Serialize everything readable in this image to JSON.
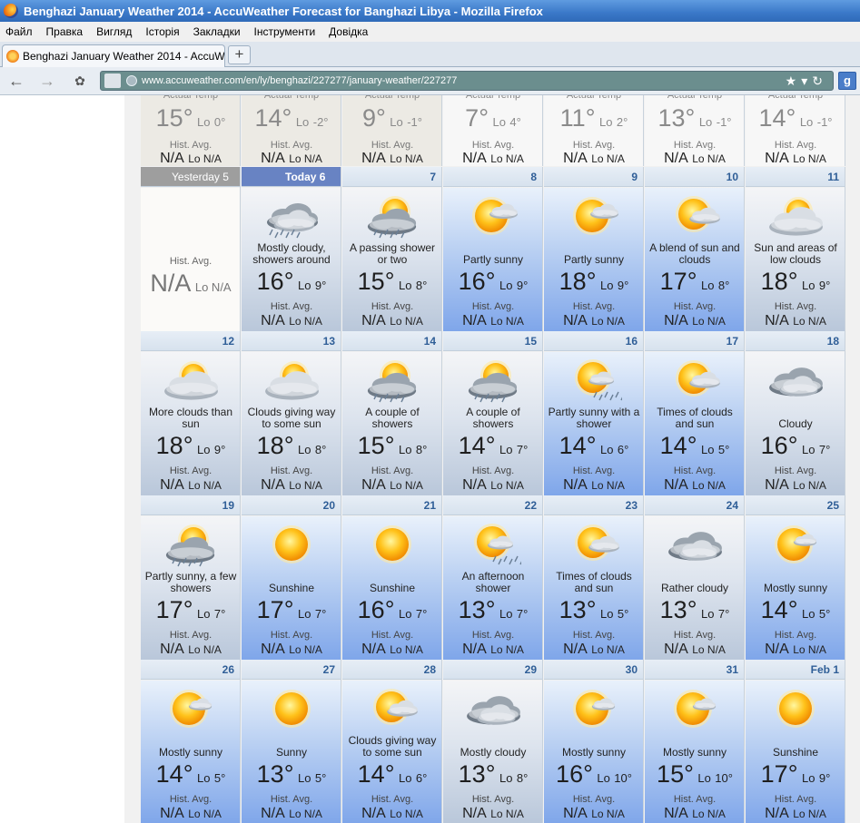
{
  "window": {
    "title": "Benghazi January Weather 2014 - AccuWeather Forecast for Banghazi Libya - Mozilla Firefox"
  },
  "menu": [
    "Файл",
    "Правка",
    "Вигляд",
    "Історія",
    "Закладки",
    "Інструменти",
    "Довідка"
  ],
  "tab": {
    "title": "Benghazi January Weather 2014 - AccuWea...",
    "new_tab": "+"
  },
  "nav": {
    "url": "www.accuweather.com/en/ly/benghazi/227277/january-weather/227277",
    "search_logo": "g"
  },
  "labels": {
    "actual_temp": "Actual Temp",
    "hist_avg": "Hist. Avg.",
    "na": "N/A",
    "lo": "Lo",
    "lo_na": "Lo N/A",
    "degree": "°"
  },
  "previous_row": [
    {
      "hi": "15",
      "lo": "0"
    },
    {
      "hi": "14",
      "lo": "-2"
    },
    {
      "hi": "9",
      "lo": "-1"
    },
    {
      "hi": "7",
      "lo": "4"
    },
    {
      "hi": "11",
      "lo": "2"
    },
    {
      "hi": "13",
      "lo": "-1"
    },
    {
      "hi": "14",
      "lo": "-1"
    }
  ],
  "weeks": [
    [
      {
        "day": "Yesterday 5",
        "kind": "yesterday"
      },
      {
        "day": "Today 6",
        "kind": "today",
        "icon": "cloud-showers-icon",
        "desc": "Mostly cloudy, showers around",
        "hi": "16",
        "lo": "9"
      },
      {
        "day": "7",
        "icon": "sun-cloud-showers-icon",
        "desc": "A passing shower or two",
        "hi": "15",
        "lo": "8"
      },
      {
        "day": "8",
        "icon": "partly-sunny-icon",
        "desc": "Partly sunny",
        "hi": "16",
        "lo": "9"
      },
      {
        "day": "9",
        "icon": "partly-sunny-icon",
        "desc": "Partly sunny",
        "hi": "18",
        "lo": "9"
      },
      {
        "day": "10",
        "icon": "sun-clouds-icon",
        "desc": "A blend of sun and clouds",
        "hi": "17",
        "lo": "8"
      },
      {
        "day": "11",
        "icon": "cloud-sun-icon",
        "desc": "Sun and areas of low clouds",
        "hi": "18",
        "lo": "9"
      }
    ],
    [
      {
        "day": "12",
        "icon": "cloud-sun-icon",
        "desc": "More clouds than sun",
        "hi": "18",
        "lo": "9"
      },
      {
        "day": "13",
        "icon": "cloud-sun-icon",
        "desc": "Clouds giving way to some sun",
        "hi": "18",
        "lo": "8"
      },
      {
        "day": "14",
        "icon": "sun-cloud-showers-icon",
        "desc": "A couple of showers",
        "hi": "15",
        "lo": "8"
      },
      {
        "day": "15",
        "icon": "sun-cloud-showers-icon",
        "desc": "A couple of showers",
        "hi": "14",
        "lo": "7"
      },
      {
        "day": "16",
        "icon": "sun-shower-icon",
        "desc": "Partly sunny with a shower",
        "hi": "14",
        "lo": "6"
      },
      {
        "day": "17",
        "icon": "sun-clouds-icon",
        "desc": "Times of clouds and sun",
        "hi": "14",
        "lo": "5"
      },
      {
        "day": "18",
        "icon": "cloud-icon",
        "desc": "Cloudy",
        "hi": "16",
        "lo": "7"
      }
    ],
    [
      {
        "day": "19",
        "icon": "sun-cloud-showers-icon",
        "desc": "Partly sunny, a few showers",
        "hi": "17",
        "lo": "7"
      },
      {
        "day": "20",
        "icon": "sun-icon",
        "desc": "Sunshine",
        "hi": "17",
        "lo": "7"
      },
      {
        "day": "21",
        "icon": "sun-icon",
        "desc": "Sunshine",
        "hi": "16",
        "lo": "7"
      },
      {
        "day": "22",
        "icon": "sun-shower-icon",
        "desc": "An afternoon shower",
        "hi": "13",
        "lo": "7"
      },
      {
        "day": "23",
        "icon": "sun-clouds-icon",
        "desc": "Times of clouds and sun",
        "hi": "13",
        "lo": "5"
      },
      {
        "day": "24",
        "icon": "cloud-icon",
        "desc": "Rather cloudy",
        "hi": "13",
        "lo": "7"
      },
      {
        "day": "25",
        "icon": "mostly-sunny-icon",
        "desc": "Mostly sunny",
        "hi": "14",
        "lo": "5"
      }
    ],
    [
      {
        "day": "26",
        "icon": "mostly-sunny-icon",
        "desc": "Mostly sunny",
        "hi": "14",
        "lo": "5"
      },
      {
        "day": "27",
        "icon": "sun-icon",
        "desc": "Sunny",
        "hi": "13",
        "lo": "5"
      },
      {
        "day": "28",
        "icon": "sun-clouds-icon",
        "desc": "Clouds giving way to some sun",
        "hi": "14",
        "lo": "6"
      },
      {
        "day": "29",
        "icon": "cloud-icon",
        "desc": "Mostly cloudy",
        "hi": "13",
        "lo": "8"
      },
      {
        "day": "30",
        "icon": "mostly-sunny-icon",
        "desc": "Mostly sunny",
        "hi": "16",
        "lo": "10"
      },
      {
        "day": "31",
        "icon": "mostly-sunny-icon",
        "desc": "Mostly sunny",
        "hi": "15",
        "lo": "10"
      },
      {
        "day": "Feb 1",
        "icon": "sun-icon",
        "desc": "Sunshine",
        "hi": "17",
        "lo": "9"
      }
    ]
  ]
}
